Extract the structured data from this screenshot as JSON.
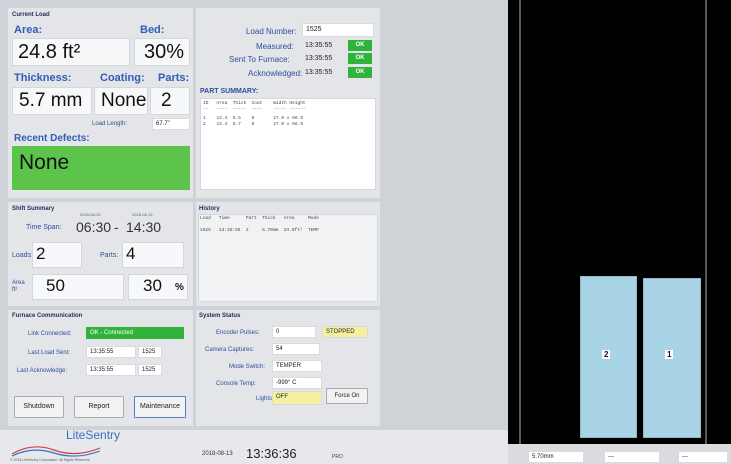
{
  "current_load": {
    "section_title": "Current Load",
    "area_label": "Area:",
    "area_value": "24.8 ft²",
    "bed_label": "Bed:",
    "bed_value": "30%",
    "thickness_label": "Thickness:",
    "thickness_value": "5.7 mm",
    "coating_label": "Coating:",
    "coating_value": "None",
    "parts_label": "Parts:",
    "parts_value": "2",
    "load_length_label": "Load Length:",
    "load_length_value": "67.7\"",
    "recent_defects_label": "Recent Defects:",
    "recent_defects_value": "None",
    "load_number_label": "Load Number:",
    "load_number_value": "1525",
    "measured_label": "Measured:",
    "measured_time": "13:35:55",
    "measured_status": "OK",
    "sent_label": "Sent To Furnace:",
    "sent_time": "13:35:55",
    "sent_status": "OK",
    "ack_label": "Acknowledged:",
    "ack_time": "13:35:55",
    "ack_status": "OK",
    "part_summary_label": "PART SUMMARY:",
    "part_summary_header": "ID   Area  Thick  Coat    Width Height",
    "part_summary_divider": "--   ----  -----  ----    ----- ------",
    "part_summary_row1": "1    12.4  5.5    0       27.0 x 66.9",
    "part_summary_row2": "2    12.4  5.7    0       27.0 x 66.9"
  },
  "shift_summary": {
    "section_title": "Shift Summary",
    "time_span_label": "Time Span:",
    "start_date": "2018-08-13",
    "start_time": "06:30",
    "separator": "-",
    "end_date": "2018-08-13",
    "end_time": "14:30",
    "loads_label": "Loads:",
    "loads_value": "2",
    "parts_label": "Parts:",
    "parts_value": "4",
    "area_label": "Area ft²",
    "area_value": "50",
    "pct_value": "30",
    "pct_unit": "%"
  },
  "history": {
    "section_title": "History",
    "header": "Load   Time      Part  Thick   Area     Mode",
    "row1": "1525   13:35:55  2     5.70mm  24.8ft²  TEMP"
  },
  "furnace": {
    "section_title": "Furnace Communication",
    "link_label": "Link Connected:",
    "link_value": "OK - Connected",
    "last_load_label": "Last Load Sent:",
    "last_load_time": "13:35:55",
    "last_load_num": "1525",
    "last_ack_label": "Last Acknowledge:",
    "last_ack_time": "13:35:55",
    "last_ack_num": "1525"
  },
  "system_status": {
    "section_title": "System Status",
    "encoder_label": "Encoder Pulses:",
    "encoder_value": "0",
    "encoder_state": "STOPPED",
    "camera_label": "Camera Captures:",
    "camera_value": "54",
    "mode_label": "Mode Switch:",
    "mode_value": "TEMPER",
    "temp_label": "Console Temp:",
    "temp_value": "-999° C",
    "lights_label": "Lights:",
    "lights_value": "OFF",
    "force_on_label": "Force On"
  },
  "buttons": {
    "shutdown": "Shutdown",
    "report": "Report",
    "maintenance": "Maintenance"
  },
  "footer": {
    "logo_text": "LiteSentry",
    "copyright": "© 2018 LiteSentry Corporation. All Rights Reserved",
    "date": "2018-08-13",
    "time": "13:36:36",
    "extra": "PRO"
  },
  "viewer": {
    "glass_labels": [
      "2",
      "1"
    ],
    "thickness_readout": "5.70mm",
    "field2": "---",
    "field3": "---"
  },
  "colors": {
    "ok_green": "#2fb33a",
    "defect_green": "#5cc44a",
    "warn_yellow": "#f5f0a0",
    "glass_blue": "#a8d4e6"
  }
}
